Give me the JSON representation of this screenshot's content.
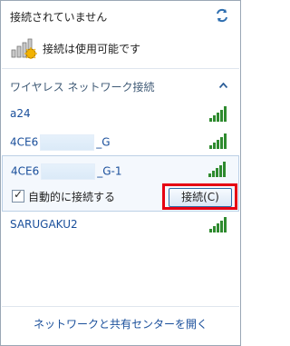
{
  "status": {
    "title": "接続されていません",
    "subtitle": "接続は使用可能です"
  },
  "section": {
    "title": "ワイヤレス ネットワーク接続"
  },
  "networks": [
    {
      "name": "a24"
    },
    {
      "name_prefix": "4CE6",
      "name_suffix": "_G"
    },
    {
      "name_prefix": "4CE6",
      "name_suffix": "_G-1",
      "selected": true
    },
    {
      "name": "SARUGAKU2"
    }
  ],
  "selected_network": {
    "auto_connect_label": "自動的に接続する",
    "connect_button_label": "接続(C)"
  },
  "footer": {
    "link": "ネットワークと共有センターを開く"
  },
  "colors": {
    "link": "#1a4f9b",
    "section_title": "#3f5a76",
    "highlight_outline": "#e60012",
    "signal": "#2f8b2f"
  },
  "icons": [
    "refresh-icon",
    "network-status-icon",
    "collapse-chevron-icon",
    "signal-strength-icon"
  ]
}
